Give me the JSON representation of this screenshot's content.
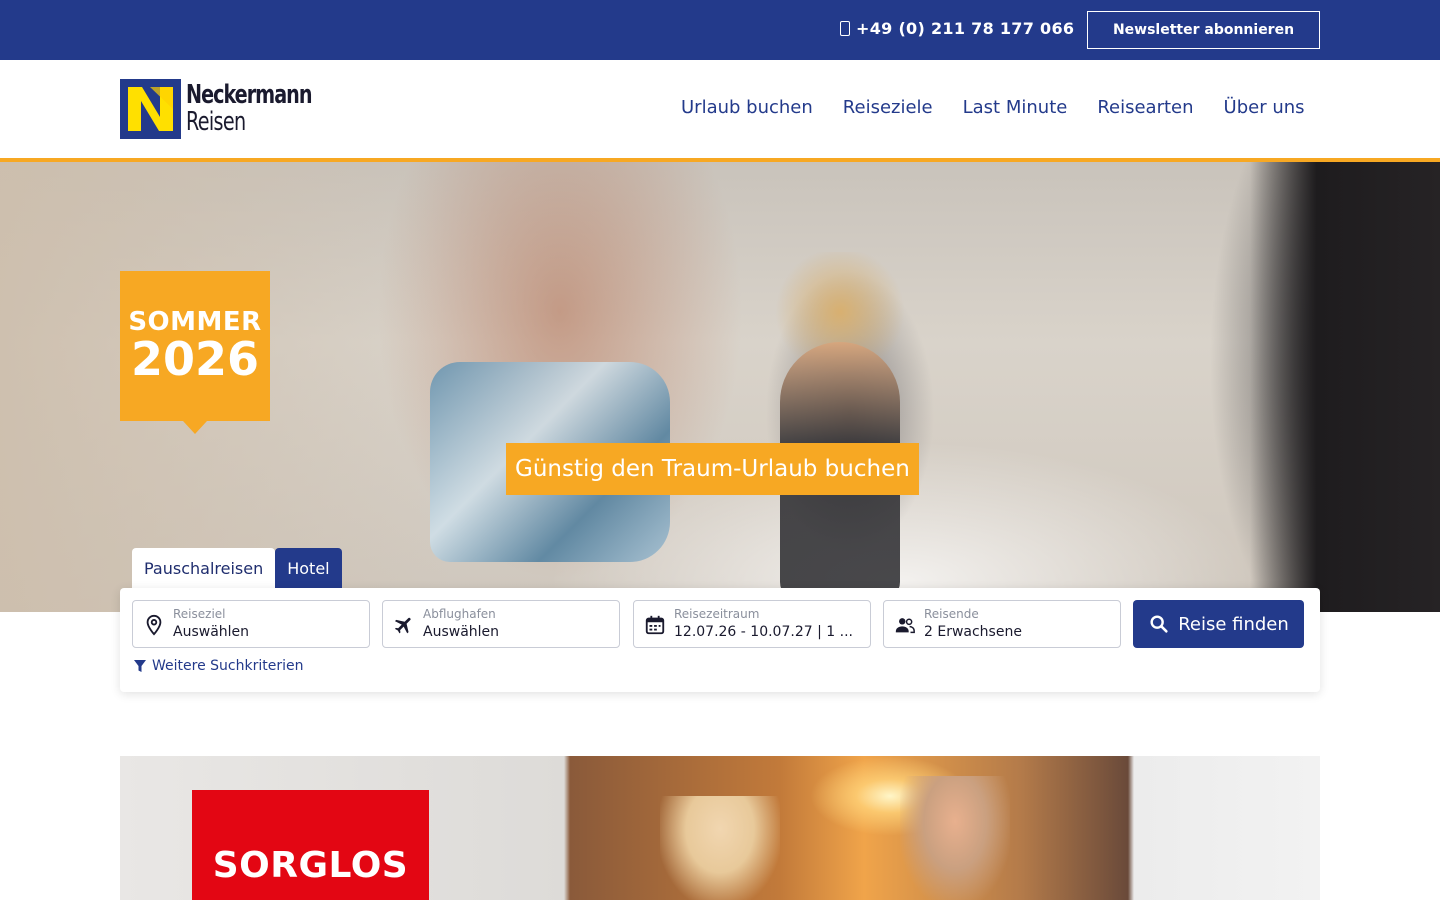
{
  "topbar": {
    "phone": "+49 (0) 211 78 177 066",
    "newsletter_label": "Newsletter abonnieren"
  },
  "header": {
    "logo_line1": "Neckermann",
    "logo_line2": "Reisen",
    "nav": [
      "Urlaub buchen",
      "Reiseziele",
      "Last Minute",
      "Reisearten",
      "Über uns"
    ]
  },
  "hero": {
    "badge_line1": "SOMMER",
    "badge_line2": "2026",
    "tagline": "Günstig den Traum-Urlaub buchen"
  },
  "search": {
    "tabs": [
      "Pauschalreisen",
      "Hotel"
    ],
    "active_tab": "Pauschalreisen",
    "fields": [
      {
        "label": "Reiseziel",
        "value": "Auswählen",
        "icon": "location-pin-icon"
      },
      {
        "label": "Abflughafen",
        "value": "Auswählen",
        "icon": "airplane-icon"
      },
      {
        "label": "Reisezeitraum",
        "value": "12.07.26 - 10.07.27 | 1 ...",
        "icon": "calendar-icon"
      },
      {
        "label": "Reisende",
        "value": "2 Erwachsene",
        "icon": "people-icon"
      }
    ],
    "submit_label": "Reise finden",
    "more_criteria": "Weitere Suchkriterien"
  },
  "promo": {
    "headline": "SORGLOS"
  },
  "colors": {
    "brand_blue": "#233a8b",
    "accent_orange": "#f7a823",
    "promo_red": "#e30613"
  }
}
